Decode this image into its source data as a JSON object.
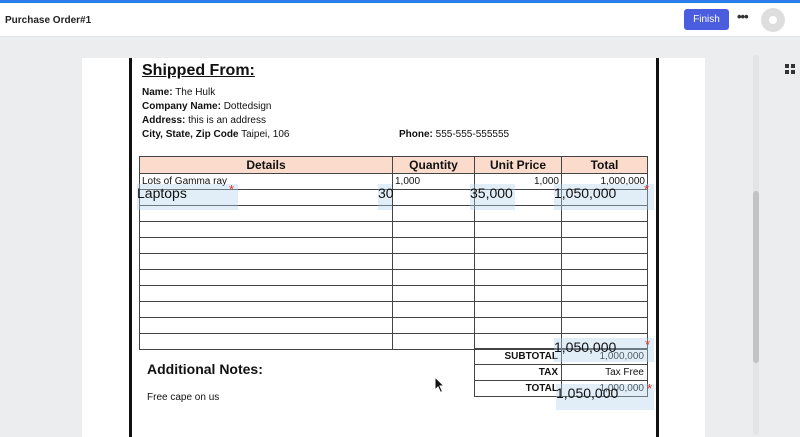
{
  "header": {
    "title": "Purchase Order#1",
    "finish_label": "Finish",
    "more_label": "•••"
  },
  "document": {
    "section_title": "Shipped From:",
    "info": {
      "name_label": "Name:",
      "name_value": "The Hulk",
      "company_label": "Company Name:",
      "company_value": "Dottedsign",
      "address_label": "Address:",
      "address_value": "this is an address",
      "city_label": "City, State, Zip Code",
      "city_value": "Taipei, 106",
      "phone_label": "Phone:",
      "phone_value": "555-555-555555"
    },
    "table": {
      "headers": [
        "Details",
        "Quantity",
        "Unit Price",
        "Total"
      ],
      "row1": {
        "details": "Lots of Gamma ray",
        "quantity": "1,000",
        "unit_price": "1,000",
        "total": "1,000,000"
      }
    },
    "summary": {
      "subtotal_label": "SUBTOTAL",
      "subtotal_value": "1,000,000",
      "tax_label": "TAX",
      "tax_value": "Tax Free",
      "total_label": "TOTAL",
      "total_value": "1,000,000"
    },
    "notes_title": "Additional Notes:",
    "notes_text": "Free cape on us"
  },
  "fields": {
    "laptops": "Laptops",
    "quantity": "30",
    "unit_price": "35,000",
    "line_total": "1,050,000",
    "subtotal": "1,050,000",
    "total": "1,050,000",
    "required_mark": "*"
  }
}
